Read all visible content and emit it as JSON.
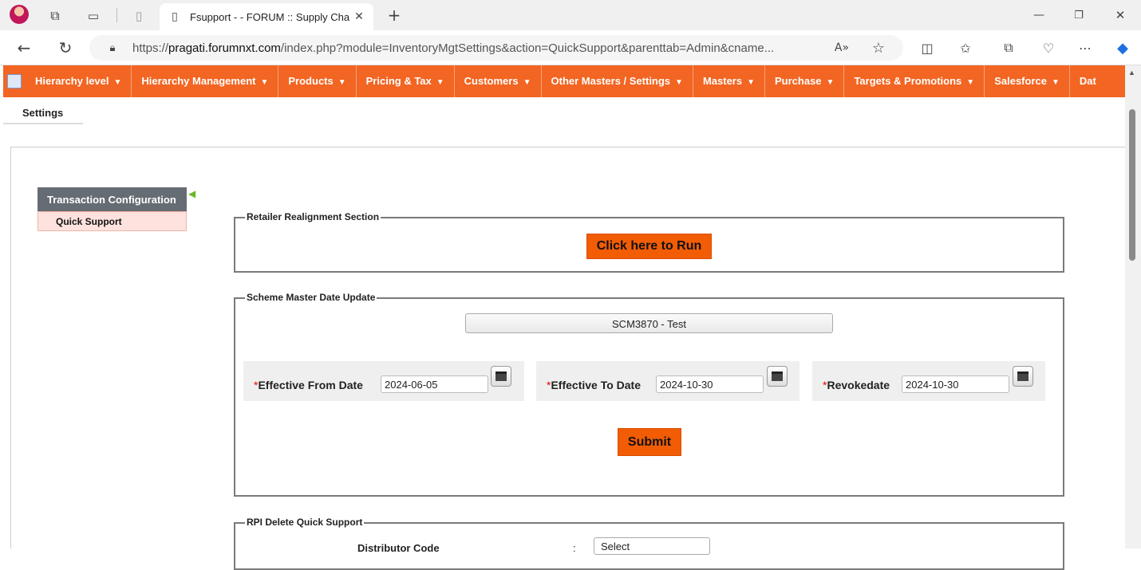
{
  "browser": {
    "tab_title": "Fsupport - - FORUM :: Supply Cha",
    "url_prefix": "https://",
    "url_host": "pragati.forumnxt.com",
    "url_path": "/index.php?module=InventoryMgtSettings&action=QuickSupport&parenttab=Admin&cname...",
    "icons": [
      "profile-avatar",
      "workspaces-icon",
      "tab-actions-icon",
      "new-page-icon",
      "tab-page-icon",
      "close-tab-icon",
      "new-tab-icon",
      "minimize-icon",
      "restore-icon",
      "close-window-icon",
      "back-icon",
      "reload-icon",
      "site-info-icon",
      "read-aloud-icon",
      "favorite-star-icon",
      "split-screen-icon",
      "favorites-icon",
      "collections-icon",
      "browser-essentials-icon",
      "more-icon",
      "copilot-icon"
    ]
  },
  "menu": {
    "items": [
      {
        "label": "Hierarchy level"
      },
      {
        "label": "Hierarchy Management"
      },
      {
        "label": "Products"
      },
      {
        "label": "Pricing & Tax"
      },
      {
        "label": "Customers"
      },
      {
        "label": "Other Masters / Settings"
      },
      {
        "label": "Masters"
      },
      {
        "label": "Purchase"
      },
      {
        "label": "Targets & Promotions"
      },
      {
        "label": "Salesforce"
      },
      {
        "label": "Dat"
      }
    ]
  },
  "subtab": {
    "label": "Settings"
  },
  "left_panel": {
    "header": "Transaction Configuration",
    "item": "Quick Support"
  },
  "retailer": {
    "legend": "Retailer Realignment Section",
    "run_button": "Click here to Run"
  },
  "scheme": {
    "legend": "Scheme Master Date Update",
    "selected": "SCM3870 - Test",
    "from_label": "Effective From Date",
    "from_value": "2024-06-05",
    "to_label": "Effective To Date",
    "to_value": "2024-10-30",
    "revoke_label": "Revokedate",
    "revoke_value": "2024-10-30",
    "required_mark": "*",
    "submit": "Submit"
  },
  "rpi": {
    "legend": "RPI Delete Quick Support",
    "distributor_label": "Distributor Code",
    "colon": ":",
    "select_placeholder": "Select"
  }
}
